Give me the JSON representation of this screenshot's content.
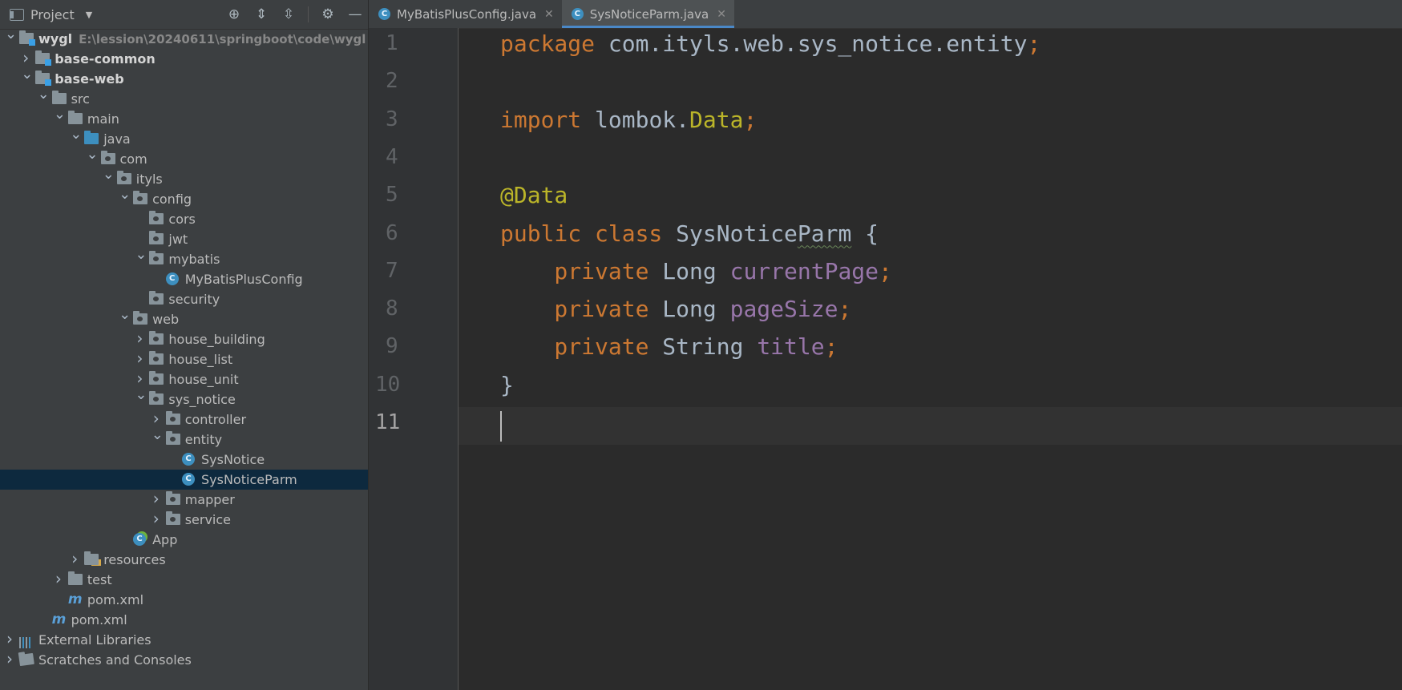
{
  "project_panel": {
    "title": "Project",
    "tools": [
      "locate-icon",
      "expand-all-icon",
      "collapse-all-icon",
      "gear-icon",
      "minimize-icon"
    ]
  },
  "tree": [
    {
      "label": "wygl",
      "path": "E:\\lession\\20240611\\springboot\\code\\wygl",
      "depth": 0,
      "arrow": "down",
      "icon": "module",
      "bold": true
    },
    {
      "label": "base-common",
      "depth": 1,
      "arrow": "right",
      "icon": "module",
      "bold": true
    },
    {
      "label": "base-web",
      "depth": 1,
      "arrow": "down",
      "icon": "module",
      "bold": true
    },
    {
      "label": "src",
      "depth": 2,
      "arrow": "down",
      "icon": "folder"
    },
    {
      "label": "main",
      "depth": 3,
      "arrow": "down",
      "icon": "folder"
    },
    {
      "label": "java",
      "depth": 4,
      "arrow": "down",
      "icon": "folder-blue"
    },
    {
      "label": "com",
      "depth": 5,
      "arrow": "down",
      "icon": "package"
    },
    {
      "label": "ityls",
      "depth": 6,
      "arrow": "down",
      "icon": "package"
    },
    {
      "label": "config",
      "depth": 7,
      "arrow": "down",
      "icon": "package"
    },
    {
      "label": "cors",
      "depth": 8,
      "arrow": "",
      "icon": "package"
    },
    {
      "label": "jwt",
      "depth": 8,
      "arrow": "",
      "icon": "package"
    },
    {
      "label": "mybatis",
      "depth": 8,
      "arrow": "down",
      "icon": "package"
    },
    {
      "label": "MyBatisPlusConfig",
      "depth": 9,
      "arrow": "",
      "icon": "class"
    },
    {
      "label": "security",
      "depth": 8,
      "arrow": "",
      "icon": "package"
    },
    {
      "label": "web",
      "depth": 7,
      "arrow": "down",
      "icon": "package"
    },
    {
      "label": "house_building",
      "depth": 8,
      "arrow": "right",
      "icon": "package"
    },
    {
      "label": "house_list",
      "depth": 8,
      "arrow": "right",
      "icon": "package"
    },
    {
      "label": "house_unit",
      "depth": 8,
      "arrow": "right",
      "icon": "package"
    },
    {
      "label": "sys_notice",
      "depth": 8,
      "arrow": "down",
      "icon": "package"
    },
    {
      "label": "controller",
      "depth": 9,
      "arrow": "right",
      "icon": "package"
    },
    {
      "label": "entity",
      "depth": 9,
      "arrow": "down",
      "icon": "package"
    },
    {
      "label": "SysNotice",
      "depth": 10,
      "arrow": "",
      "icon": "class"
    },
    {
      "label": "SysNoticeParm",
      "depth": 10,
      "arrow": "",
      "icon": "class",
      "selected": true
    },
    {
      "label": "mapper",
      "depth": 9,
      "arrow": "right",
      "icon": "package"
    },
    {
      "label": "service",
      "depth": 9,
      "arrow": "right",
      "icon": "package"
    },
    {
      "label": "App",
      "depth": 7,
      "arrow": "",
      "icon": "spring-class"
    },
    {
      "label": "resources",
      "depth": 4,
      "arrow": "right",
      "icon": "folder-res"
    },
    {
      "label": "test",
      "depth": 3,
      "arrow": "right",
      "icon": "folder"
    },
    {
      "label": "pom.xml",
      "depth": 3,
      "arrow": "",
      "icon": "maven"
    },
    {
      "label": "pom.xml",
      "depth": 2,
      "arrow": "",
      "icon": "maven"
    },
    {
      "label": "External Libraries",
      "depth": 0,
      "arrow": "right",
      "icon": "libraries"
    },
    {
      "label": "Scratches and Consoles",
      "depth": 0,
      "arrow": "right",
      "icon": "scratches"
    }
  ],
  "tabs": [
    {
      "label": "MyBatisPlusConfig.java",
      "active": false
    },
    {
      "label": "SysNoticeParm.java",
      "active": true
    }
  ],
  "code_lines": [
    {
      "num": "1",
      "tokens": [
        [
          "kw",
          "package "
        ],
        [
          "",
          "com.ityls.web.sys_notice.entity"
        ],
        [
          "kw",
          ";"
        ]
      ]
    },
    {
      "num": "2",
      "tokens": []
    },
    {
      "num": "3",
      "tokens": [
        [
          "kw",
          "import "
        ],
        [
          "",
          "lombok."
        ],
        [
          "ann",
          "Data"
        ],
        [
          "kw",
          ";"
        ]
      ]
    },
    {
      "num": "4",
      "tokens": []
    },
    {
      "num": "5",
      "tokens": [
        [
          "ann",
          "@Data"
        ]
      ]
    },
    {
      "num": "6",
      "tokens": [
        [
          "kw",
          "public class "
        ],
        [
          "",
          "SysNotice"
        ],
        [
          "squig",
          "Parm"
        ],
        [
          "",
          " {"
        ]
      ]
    },
    {
      "num": "7",
      "tokens": [
        [
          "kw",
          "    private "
        ],
        [
          "",
          "Long "
        ],
        [
          "fld",
          "currentPage"
        ],
        [
          "kw",
          ";"
        ]
      ]
    },
    {
      "num": "8",
      "tokens": [
        [
          "kw",
          "    private "
        ],
        [
          "",
          "Long "
        ],
        [
          "fld",
          "pageSize"
        ],
        [
          "kw",
          ";"
        ]
      ]
    },
    {
      "num": "9",
      "tokens": [
        [
          "kw",
          "    private "
        ],
        [
          "",
          "String "
        ],
        [
          "fld",
          "title"
        ],
        [
          "kw",
          ";"
        ]
      ]
    },
    {
      "num": "10",
      "tokens": [
        [
          "",
          "}"
        ]
      ]
    },
    {
      "num": "11",
      "tokens": [],
      "current": true
    }
  ]
}
